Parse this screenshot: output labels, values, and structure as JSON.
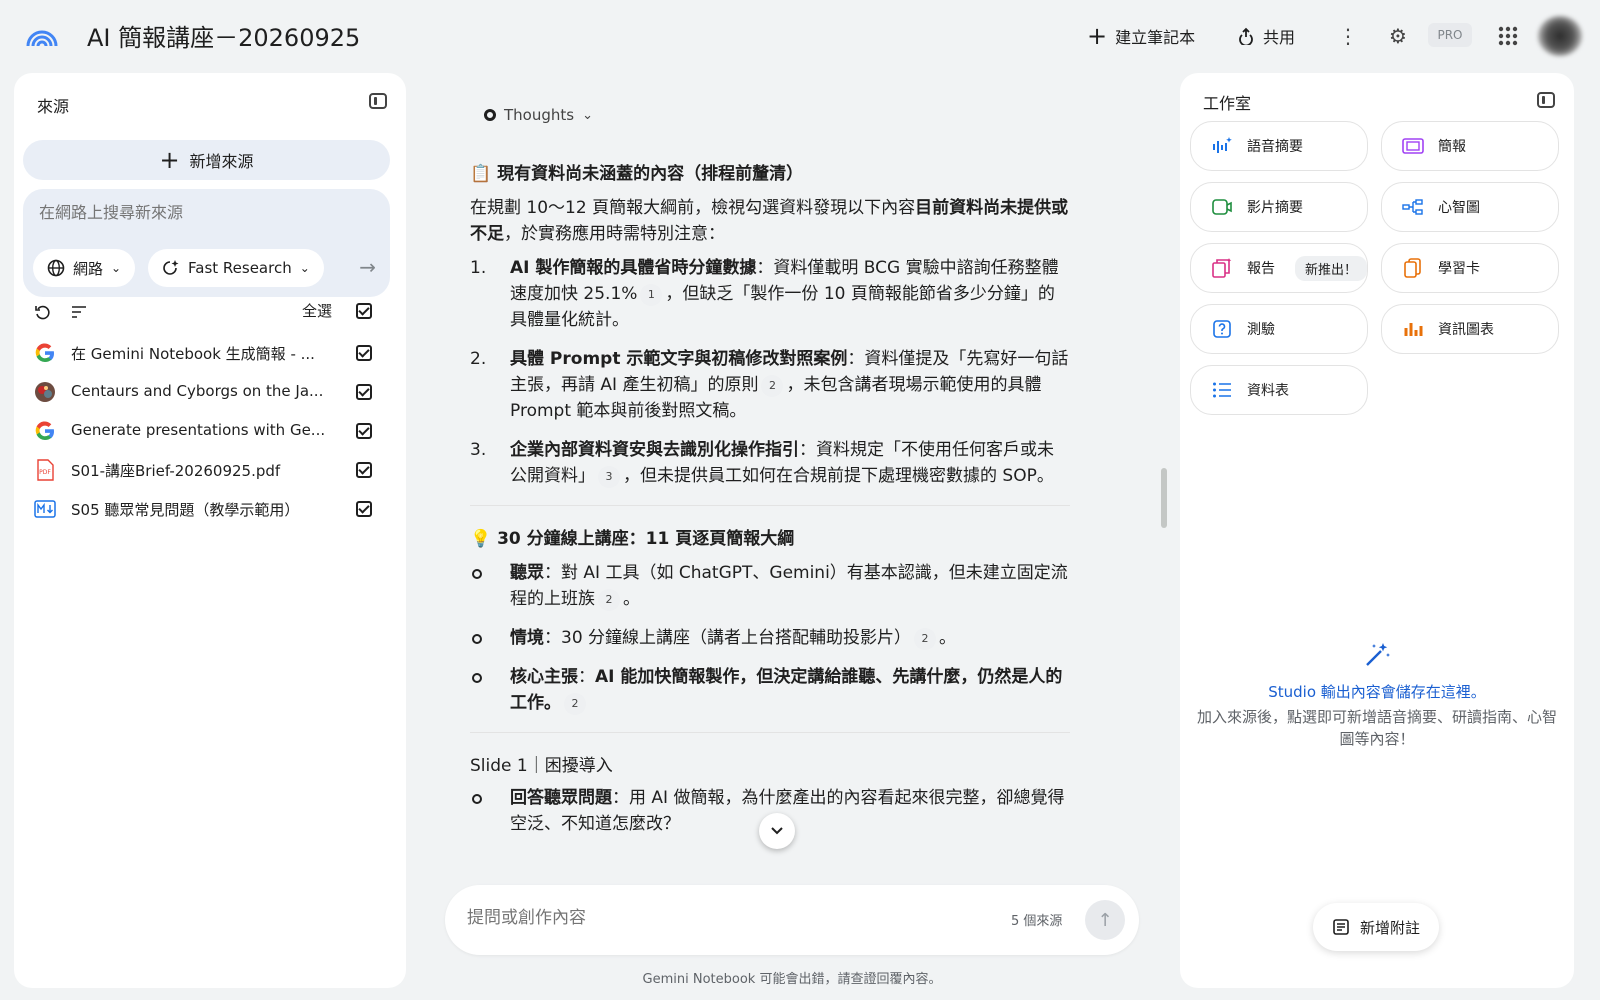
{
  "header": {
    "title": "AI 簡報講座－20260925",
    "create_notebook": "建立筆記本",
    "share": "共用",
    "pro_badge": "PRO"
  },
  "sources": {
    "title": "來源",
    "add_source": "新增來源",
    "search_placeholder": "在網路上搜尋新來源",
    "web_chip": "網路",
    "research_chip": "Fast Research",
    "select_all": "全選",
    "items": [
      {
        "label": "在 Gemini Notebook 生成簡報 - ...",
        "icon": "google-icon"
      },
      {
        "label": "Centaurs and Cyborgs on the Ja...",
        "icon": "site-favicon"
      },
      {
        "label": "Generate presentations with Ge...",
        "icon": "google-icon"
      },
      {
        "label": "S01-講座Brief-20260925.pdf",
        "icon": "pdf-icon"
      },
      {
        "label": "S05 聽眾常見問題（教學示範用）",
        "icon": "markdown-icon"
      }
    ]
  },
  "chat": {
    "thoughts_label": "Thoughts",
    "section1_title": "📋 現有資料尚未涵蓋的內容（排程前釐清）",
    "section1_intro_a": "在規劃 10～12 頁簡報大綱前，檢視勾選資料發現以下內容",
    "section1_intro_b": "目前資料尚未提供或不足",
    "section1_intro_c": "，於實務應用時需特別注意：",
    "gaps": [
      {
        "num": "1.",
        "bold": "AI 製作簡報的具體省時分鐘數據",
        "text_a": "：資料僅載明 BCG 實驗中諮詢任務整體速度加快 25.1%",
        "cite": "1",
        "text_b": "，但缺乏「製作一份 10 頁簡報能節省多少分鐘」的具體量化統計。"
      },
      {
        "num": "2.",
        "bold": "具體 Prompt 示範文字與初稿修改對照案例",
        "text_a": "：資料僅提及「先寫好一句話主張，再請 AI 產生初稿」的原則",
        "cite": "2",
        "text_b": "，未包含講者現場示範使用的具體 Prompt 範本與前後對照文稿。"
      },
      {
        "num": "3.",
        "bold": "企業內部資料資安與去識別化操作指引",
        "text_a": "：資料規定「不使用任何客戶或未公開資料」",
        "cite": "3",
        "text_b": "，但未提供員工如何在合規前提下處理機密數據的 SOP。"
      }
    ],
    "section2_title": "💡 30 分鐘線上講座：11 頁逐頁簡報大綱",
    "outline": [
      {
        "bold": "聽眾",
        "text_a": "：對 AI 工具（如 ChatGPT、Gemini）有基本認識，但未建立固定流程的上班族",
        "cite": "2",
        "text_b": "。"
      },
      {
        "bold": "情境",
        "text_a": "：30 分鐘線上講座（講者上台搭配輔助投影片）",
        "cite": "2",
        "text_b": "。"
      },
      {
        "bold": "核心主張",
        "text_a": "：",
        "bold2": "AI 能加快簡報製作，但決定講給誰聽、先講什麼，仍然是人的工作。",
        "cite": "2",
        "text_b": ""
      }
    ],
    "slide1_title": "Slide 1｜困擾導入",
    "slide1_items": [
      {
        "bold": "回答聽眾問題",
        "text_a": "：用 AI 做簡報，為什麼產出的內容看起來很完整，卻總覺得空泛、不知道怎麼改？"
      }
    ],
    "prompt_placeholder": "提問或創作內容",
    "source_count": "5 個來源",
    "disclaimer": "Gemini Notebook 可能會出錯，請查證回覆內容。"
  },
  "studio": {
    "title": "工作室",
    "tiles": [
      {
        "label": "語音摘要",
        "icon": "audio-overview-icon",
        "color": "#1a73e8"
      },
      {
        "label": "簡報",
        "icon": "slides-icon",
        "color": "#a142f4"
      },
      {
        "label": "影片摘要",
        "icon": "video-overview-icon",
        "color": "#1e8e3e"
      },
      {
        "label": "心智圖",
        "icon": "mind-map-icon",
        "color": "#1a73e8"
      },
      {
        "label": "報告",
        "icon": "report-icon",
        "badge": "新推出！",
        "color": "#d93085"
      },
      {
        "label": "學習卡",
        "icon": "flashcards-icon",
        "color": "#e8710a"
      },
      {
        "label": "測驗",
        "icon": "quiz-icon",
        "color": "#1a73e8"
      },
      {
        "label": "資訊圖表",
        "icon": "infographic-icon",
        "color": "#e8710a"
      },
      {
        "label": "資料表",
        "icon": "data-table-icon",
        "color": "#1a73e8"
      }
    ],
    "empty_title": "Studio 輸出內容會儲存在這裡。",
    "empty_desc": "加入來源後，點選即可新增語音摘要、研讀指南、心智圖等內容！",
    "add_note": "新增附註"
  }
}
